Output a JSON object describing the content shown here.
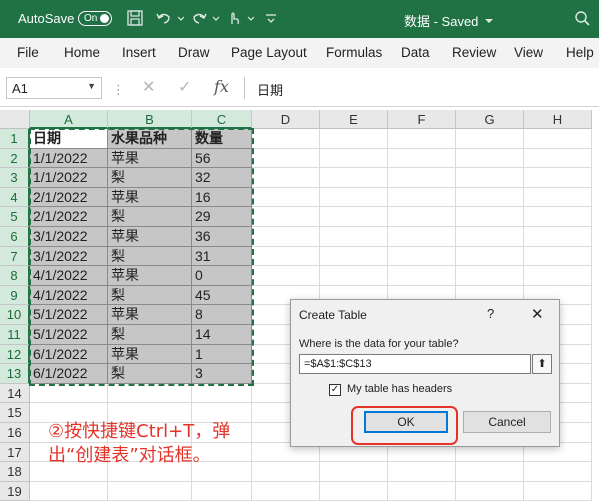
{
  "titlebar": {
    "autosave_label": "AutoSave",
    "autosave_state": "On",
    "doc_title": "数据 - Saved",
    "bg_color": "#207245"
  },
  "ribbon": {
    "tabs": [
      "File",
      "Home",
      "Insert",
      "Draw",
      "Page Layout",
      "Formulas",
      "Data",
      "Review",
      "View",
      "Help"
    ]
  },
  "formula_bar": {
    "name_box": "A1",
    "formula": "日期",
    "fx_label": "fx"
  },
  "grid": {
    "columns": [
      "A",
      "B",
      "C",
      "D",
      "E",
      "F",
      "G",
      "H"
    ],
    "rows": [
      "1",
      "2",
      "3",
      "4",
      "5",
      "6",
      "7",
      "8",
      "9",
      "10",
      "11",
      "12",
      "13",
      "14",
      "15",
      "16",
      "17",
      "18",
      "19"
    ],
    "headers": [
      "日期",
      "水果品种",
      "数量"
    ],
    "data": [
      [
        "1/1/2022",
        "苹果",
        "56"
      ],
      [
        "1/1/2022",
        "梨",
        "32"
      ],
      [
        "2/1/2022",
        "苹果",
        "16"
      ],
      [
        "2/1/2022",
        "梨",
        "29"
      ],
      [
        "3/1/2022",
        "苹果",
        "36"
      ],
      [
        "3/1/2022",
        "梨",
        "31"
      ],
      [
        "4/1/2022",
        "苹果",
        "0"
      ],
      [
        "4/1/2022",
        "梨",
        "45"
      ],
      [
        "5/1/2022",
        "苹果",
        "8"
      ],
      [
        "5/1/2022",
        "梨",
        "14"
      ],
      [
        "6/1/2022",
        "苹果",
        "1"
      ],
      [
        "6/1/2022",
        "梨",
        "3"
      ]
    ]
  },
  "annotation": {
    "line1": "②按快捷键Ctrl+T，弹",
    "line2": "出“创建表”对话框。",
    "color": "#e4342a"
  },
  "dialog": {
    "title": "Create Table",
    "help": "?",
    "close": "✕",
    "question": "Where is the data for your table?",
    "range": "=$A$1:$C$13",
    "collapse_icon": "⬆",
    "checkbox_checked": true,
    "checkbox_mark": "✓",
    "checkbox_label": "My table has headers",
    "ok_label": "OK",
    "cancel_label": "Cancel"
  }
}
